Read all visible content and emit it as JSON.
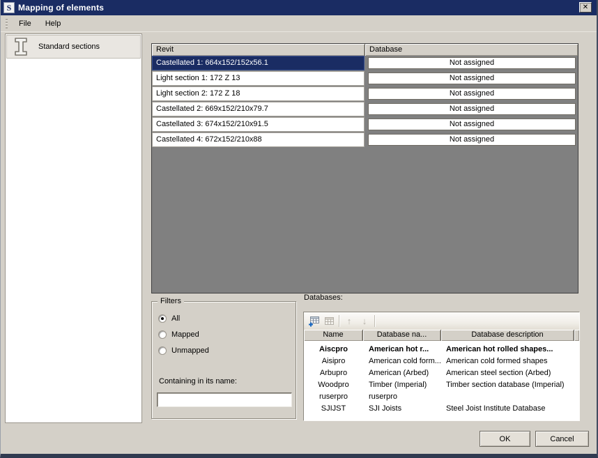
{
  "window": {
    "title": "Mapping of elements",
    "icon_letter": "S",
    "close_glyph": "✕"
  },
  "menu": {
    "file": "File",
    "help": "Help"
  },
  "sidebar": {
    "selected_item_label": "Standard sections"
  },
  "mapping_table": {
    "columns": {
      "revit": "Revit",
      "database": "Database"
    },
    "rows": [
      {
        "revit": "Castellated 1: 664x152/152x56.1",
        "database": "Not assigned",
        "selected": true
      },
      {
        "revit": "Light section 1: 172 Z 13",
        "database": "Not assigned",
        "selected": false
      },
      {
        "revit": "Light section 2: 172 Z 18",
        "database": "Not assigned",
        "selected": false
      },
      {
        "revit": "Castellated 2: 669x152/210x79.7",
        "database": "Not assigned",
        "selected": false
      },
      {
        "revit": "Castellated 3: 674x152/210x91.5",
        "database": "Not assigned",
        "selected": false
      },
      {
        "revit": "Castellated 4: 672x152/210x88",
        "database": "Not assigned",
        "selected": false
      }
    ]
  },
  "filters": {
    "title": "Filters",
    "options": [
      {
        "label": "All",
        "checked": true
      },
      {
        "label": "Mapped",
        "checked": false
      },
      {
        "label": "Unmapped",
        "checked": false
      }
    ],
    "containing_label": "Containing in its name:",
    "containing_value": ""
  },
  "databases": {
    "label": "Databases:",
    "toolbar": {
      "up_glyph": "↑",
      "down_glyph": "↓"
    },
    "columns": [
      "Name",
      "Database na...",
      "Database description"
    ],
    "rows": [
      {
        "name": "Aiscpro",
        "db_name": "American hot r...",
        "description": "American hot rolled shapes...",
        "bold": true
      },
      {
        "name": "Aisipro",
        "db_name": "American cold form...",
        "description": "American cold formed shapes",
        "bold": false
      },
      {
        "name": "Arbupro",
        "db_name": "American (Arbed)",
        "description": "American steel section (Arbed)",
        "bold": false
      },
      {
        "name": "Woodpro",
        "db_name": "Timber (Imperial)",
        "description": "Timber section database (Imperial)",
        "bold": false
      },
      {
        "name": "ruserpro",
        "db_name": "ruserpro",
        "description": "",
        "bold": false
      },
      {
        "name": "SJIJST",
        "db_name": "SJI Joists",
        "description": "Steel Joist Institute Database",
        "bold": false
      }
    ]
  },
  "buttons": {
    "ok": "OK",
    "cancel": "Cancel"
  },
  "colors": {
    "titlebar": "#1a2c63",
    "selection": "#1a2c63",
    "face": "#d4d0c8",
    "list_background": "#808080",
    "add_icon_accent": "#1565c0"
  }
}
